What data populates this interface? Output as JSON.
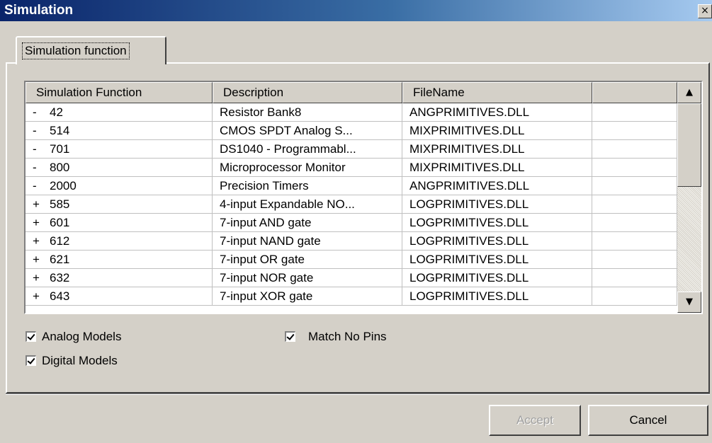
{
  "window": {
    "title": "Simulation",
    "close_glyph": "×"
  },
  "tabs": [
    {
      "label": "Simulation function"
    }
  ],
  "table": {
    "columns": [
      "Simulation Function",
      "Description",
      "FileName",
      ""
    ],
    "rows": [
      {
        "sign": "-",
        "func": "42",
        "desc": "Resistor Bank8",
        "file": "ANGPRIMITIVES.DLL"
      },
      {
        "sign": "-",
        "func": "514",
        "desc": "CMOS SPDT Analog S...",
        "file": "MIXPRIMITIVES.DLL"
      },
      {
        "sign": "-",
        "func": "701",
        "desc": "DS1040 - Programmabl...",
        "file": "MIXPRIMITIVES.DLL"
      },
      {
        "sign": "-",
        "func": "800",
        "desc": "Microprocessor Monitor",
        "file": "MIXPRIMITIVES.DLL"
      },
      {
        "sign": "-",
        "func": "2000",
        "desc": "Precision Timers",
        "file": "ANGPRIMITIVES.DLL"
      },
      {
        "sign": "+",
        "func": "585",
        "desc": "4-input Expandable NO...",
        "file": "LOGPRIMITIVES.DLL"
      },
      {
        "sign": "+",
        "func": "601",
        "desc": "7-input AND gate",
        "file": "LOGPRIMITIVES.DLL"
      },
      {
        "sign": "+",
        "func": "612",
        "desc": "7-input NAND gate",
        "file": "LOGPRIMITIVES.DLL"
      },
      {
        "sign": "+",
        "func": "621",
        "desc": "7-input OR gate",
        "file": "LOGPRIMITIVES.DLL"
      },
      {
        "sign": "+",
        "func": "632",
        "desc": "7-input NOR gate",
        "file": "LOGPRIMITIVES.DLL"
      },
      {
        "sign": "+",
        "func": "643",
        "desc": "7-input XOR gate",
        "file": "LOGPRIMITIVES.DLL"
      }
    ],
    "scroll_up_glyph": "▲",
    "scroll_down_glyph": "▼"
  },
  "options": {
    "analog_models": {
      "label": "Analog Models",
      "checked": true
    },
    "digital_models": {
      "label": "Digital Models",
      "checked": true
    },
    "match_no_pins": {
      "label": "Match No Pins",
      "checked": true
    }
  },
  "buttons": {
    "accept": {
      "label": "Accept",
      "enabled": false
    },
    "cancel": {
      "label": "Cancel",
      "enabled": true
    }
  },
  "colors": {
    "dialog_bg": "#d4d0c8",
    "titlebar_start": "#0a246a",
    "titlebar_end": "#a6caf0"
  }
}
